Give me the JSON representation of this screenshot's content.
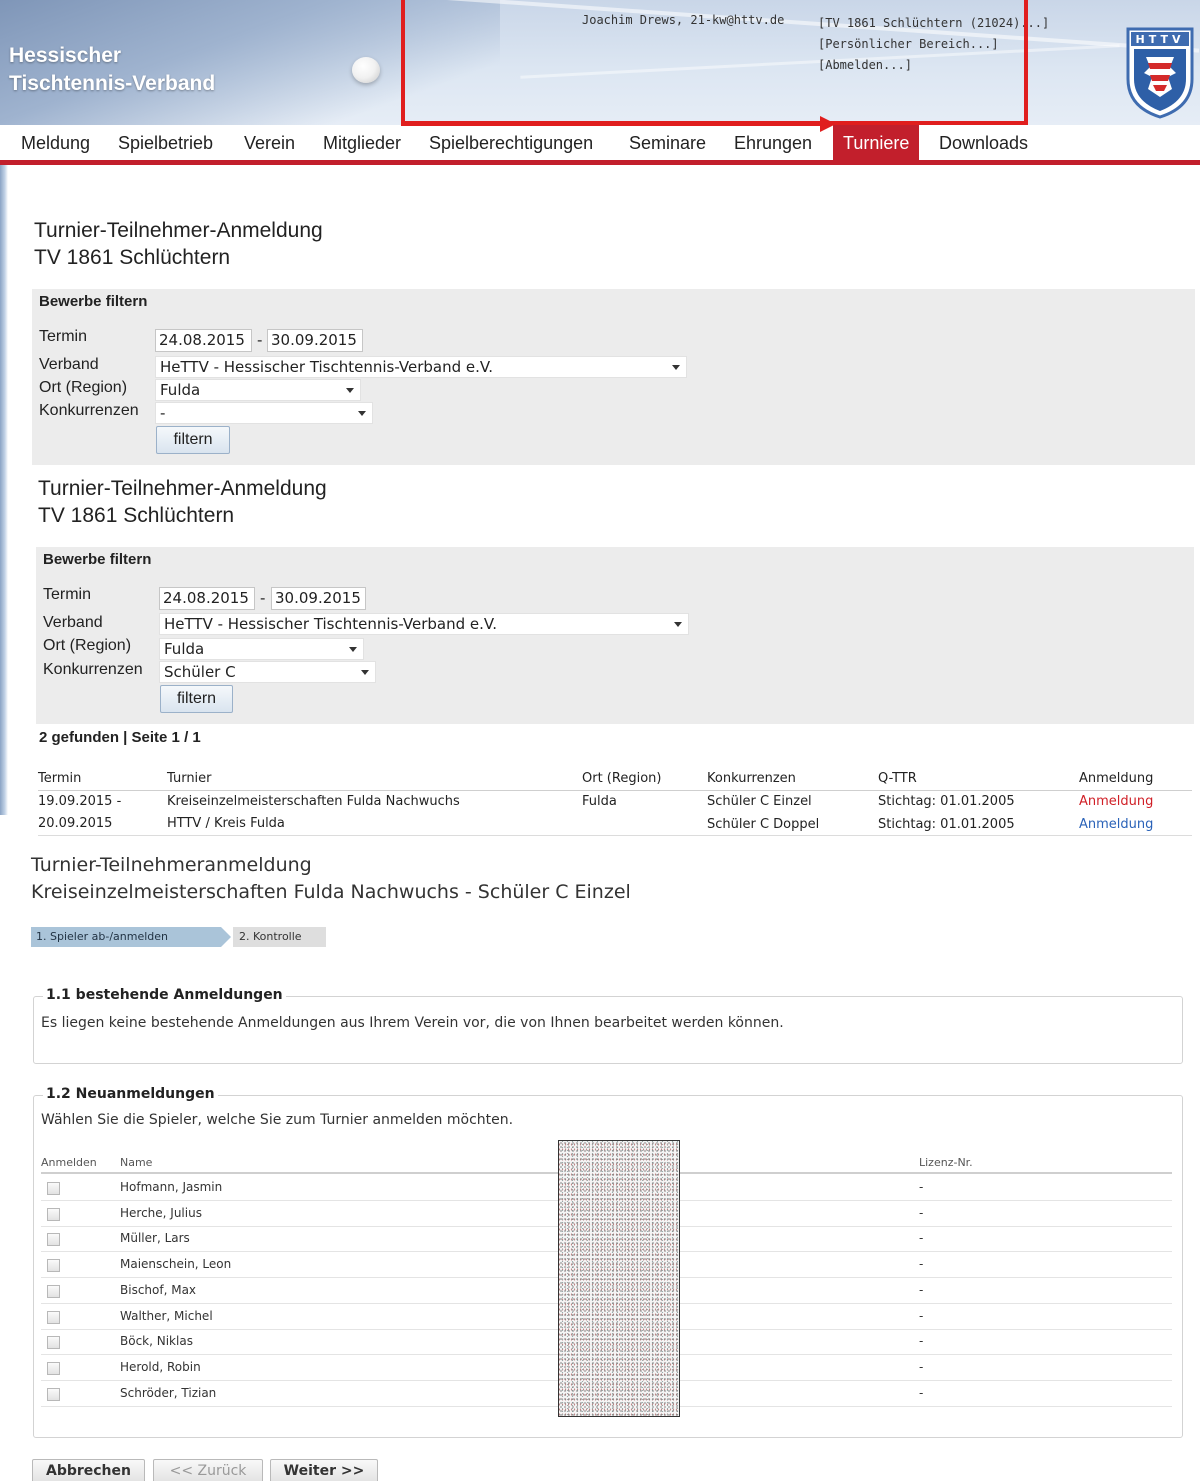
{
  "header": {
    "brand_line1": "Hessischer",
    "brand_line2": "Tischtennis-Verband",
    "user": "Joachim Drews, 21-kw@httv.de",
    "links": [
      "[TV 1861 Schlüchtern (21024)...]",
      "[Persönlicher Bereich...]",
      "[Abmelden...]"
    ],
    "crest_text": "HTTV"
  },
  "nav": {
    "items": [
      "Meldung",
      "Spielbetrieb",
      "Verein",
      "Mitglieder",
      "Spielberechtigungen",
      "Seminare",
      "Ehrungen",
      "Turniere",
      "Downloads"
    ],
    "active": "Turniere"
  },
  "colors": {
    "brand_red": "#c21f2c",
    "annotation_red": "#e01e1e",
    "link_blue": "#2a62b8"
  },
  "section1": {
    "title_line1": "Turnier-Teilnehmer-Anmeldung",
    "title_line2": "TV 1861 Schlüchtern",
    "filter_heading": "Bewerbe filtern",
    "labels": {
      "termin": "Termin",
      "verband": "Verband",
      "ort": "Ort (Region)",
      "konkurrenzen": "Konkurrenzen"
    },
    "date_from": "24.08.2015",
    "date_sep": "-",
    "date_to": "30.09.2015",
    "verband": "HeTTV - Hessischer Tischtennis-Verband e.V.",
    "ort": "Fulda",
    "konkurrenzen": "-",
    "button": "filtern"
  },
  "section2": {
    "title_line1": "Turnier-Teilnehmer-Anmeldung",
    "title_line2": "TV 1861 Schlüchtern",
    "filter_heading": "Bewerbe filtern",
    "labels": {
      "termin": "Termin",
      "verband": "Verband",
      "ort": "Ort (Region)",
      "konkurrenzen": "Konkurrenzen"
    },
    "date_from": "24.08.2015",
    "date_sep": "-",
    "date_to": "30.09.2015",
    "verband": "HeTTV - Hessischer Tischtennis-Verband e.V.",
    "ort": "Fulda",
    "konkurrenzen": "Schüler C",
    "button": "filtern",
    "results_heading": "2 gefunden | Seite 1 / 1",
    "columns": [
      "Termin",
      "Turnier",
      "Ort (Region)",
      "Konkurrenzen",
      "Q-TTR",
      "Anmeldung"
    ],
    "row": {
      "termin_line1": "19.09.2015 -",
      "termin_line2": "20.09.2015",
      "turnier_line1": "Kreiseinzelmeisterschaften Fulda Nachwuchs",
      "turnier_line2": "HTTV / Kreis Fulda",
      "ort": "Fulda",
      "konk1": "Schüler C Einzel",
      "konk2": "Schüler C Doppel",
      "qttr1": "Stichtag: 01.01.2005",
      "qttr2": "Stichtag: 01.01.2005",
      "anm1": "Anmeldung",
      "anm2": "Anmeldung"
    }
  },
  "section3": {
    "title_line1": "Turnier-Teilnehmeranmeldung",
    "title_line2": "Kreiseinzelmeisterschaften Fulda Nachwuchs - Schüler C Einzel",
    "steps": [
      "1. Spieler ab-/anmelden",
      "2. Kontrolle"
    ],
    "existing_legend": "1.1 bestehende Anmeldungen",
    "existing_text": "Es liegen keine bestehende Anmeldungen aus Ihrem Verein vor, die von Ihnen bearbeitet werden können.",
    "new_legend": "1.2 Neuanmeldungen",
    "new_text": "Wählen Sie die Spieler, welche Sie zum Turnier anmelden möchten.",
    "columns": [
      "Anmelden",
      "Name",
      "Lizenz-Nr."
    ],
    "players": [
      {
        "name": "Hofmann, Jasmin",
        "lizenz": "-"
      },
      {
        "name": "Herche, Julius",
        "lizenz": "-"
      },
      {
        "name": "Müller, Lars",
        "lizenz": "-"
      },
      {
        "name": "Maienschein, Leon",
        "lizenz": "-"
      },
      {
        "name": "Bischof, Max",
        "lizenz": "-"
      },
      {
        "name": "Walther, Michel",
        "lizenz": "-"
      },
      {
        "name": "Böck, Niklas",
        "lizenz": "-"
      },
      {
        "name": "Herold, Robin",
        "lizenz": "-"
      },
      {
        "name": "Schröder, Tizian",
        "lizenz": "-"
      }
    ],
    "buttons": {
      "cancel": "Abbrechen",
      "back": "<< Zurück",
      "next": "Weiter >>"
    }
  }
}
